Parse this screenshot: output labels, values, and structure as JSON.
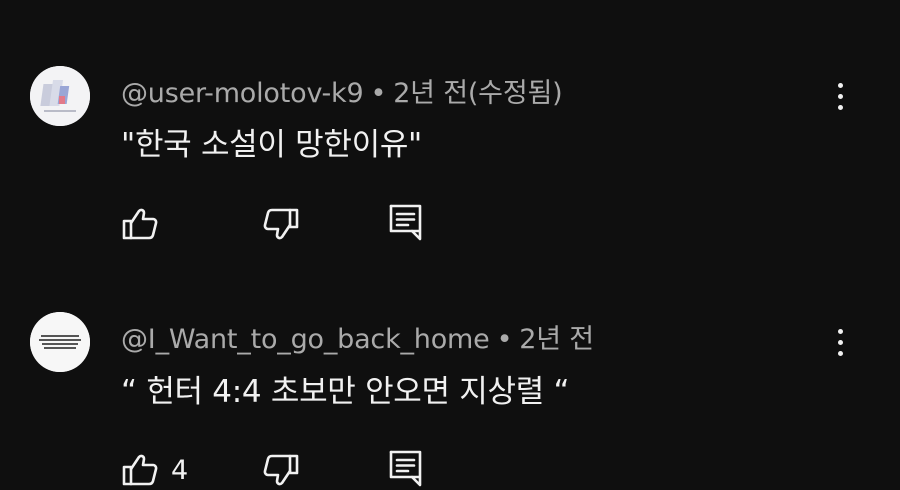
{
  "comments": [
    {
      "author": "@user-molotov-k9",
      "separator": "•",
      "time": "2년 전(수정됨)",
      "text": "\"한국 소설이 망한이유\"",
      "like_count": "",
      "avatar_icon": "generated-abstract-avatar-icon"
    },
    {
      "author": "@I_Want_to_go_back_home",
      "separator": "•",
      "time": "2년 전",
      "text": "“ 헌터 4:4 초보만 안오면 지상렬 “",
      "like_count": "4",
      "avatar_icon": "text-logo-avatar-icon"
    }
  ],
  "colors": {
    "background": "#0f0f0f",
    "primary_text": "#f1f1f1",
    "secondary_text": "#aaaaaa"
  }
}
